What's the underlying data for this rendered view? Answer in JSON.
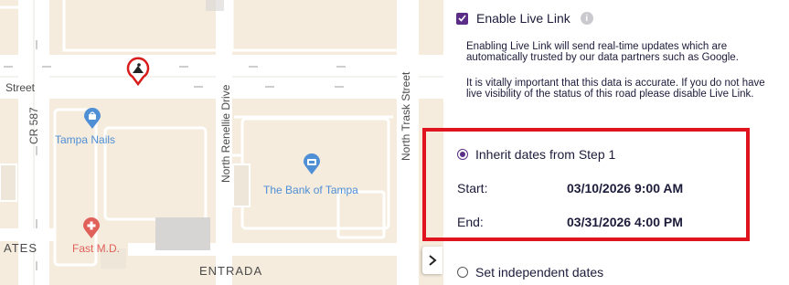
{
  "map": {
    "streets": {
      "street_west": "Street",
      "cr587": "CR 587",
      "renellie": "North Renellie Drive",
      "trask": "North Trask Street",
      "entrada": "ENTRADA",
      "ates": "ATES"
    },
    "pois": {
      "tampa_nails": "Tampa Nails",
      "bank_of_tampa": "The Bank of Tampa",
      "fast_md": "Fast M.D."
    },
    "colors": {
      "road": "#ffffff",
      "block": "#f5ecdd",
      "building": "#d7d5d4",
      "poi_blue": "#4f8fd6",
      "poi_red": "#e0605a",
      "closure": "#d81b1b"
    }
  },
  "panel": {
    "enable_live_link": {
      "label": "Enable Live Link",
      "checked": true,
      "info_icon": "i"
    },
    "paragraph1": "Enabling Live Link will send real-time updates which are automatically trusted by our data partners such as Google.",
    "paragraph2": "It is vitally important that this data is accurate. If you do not have live visibility of the status of this road please disable Live Link.",
    "inherit": {
      "label": "Inherit dates from Step 1",
      "selected": true
    },
    "start": {
      "label": "Start:",
      "value": "03/10/2026 9:00 AM"
    },
    "end": {
      "label": "End:",
      "value": "03/31/2026 4:00 PM"
    },
    "independent": {
      "label": "Set independent dates",
      "selected": false
    },
    "accent_color": "#5b2d86",
    "highlight_color": "#e0141e"
  },
  "collapse_button": {
    "icon": "chevron-right-icon"
  }
}
